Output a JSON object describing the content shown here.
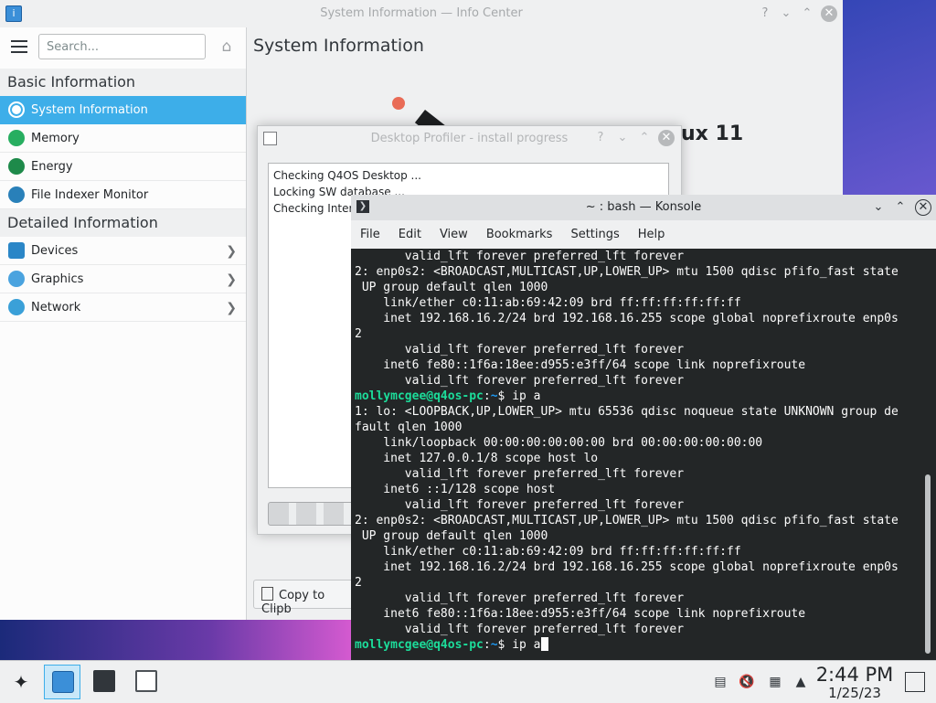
{
  "infocenter": {
    "window_title": "System Information — Info Center",
    "search_placeholder": "Search...",
    "sections": [
      {
        "title": "Basic Information",
        "items": [
          {
            "label": "System Information",
            "icon": "info-icon",
            "color": "#3b8fd8",
            "selected": true
          },
          {
            "label": "Memory",
            "icon": "memory-icon",
            "color": "#27ae60"
          },
          {
            "label": "Energy",
            "icon": "energy-icon",
            "color": "#1e8a4a"
          },
          {
            "label": "File Indexer Monitor",
            "icon": "file-indexer-icon",
            "color": "#2980b9"
          }
        ]
      },
      {
        "title": "Detailed Information",
        "items": [
          {
            "label": "Devices",
            "icon": "devices-icon",
            "color": "#2a86c7",
            "chevron": true
          },
          {
            "label": "Graphics",
            "icon": "graphics-icon",
            "color": "#4aa3df",
            "chevron": true
          },
          {
            "label": "Network",
            "icon": "network-icon",
            "color": "#3aa0d8",
            "chevron": true
          }
        ]
      }
    ],
    "page_title": "System Information",
    "os_name_fragment": "ux 11",
    "copy_button_label": "Copy to Clipb"
  },
  "profiler_dialog": {
    "title": "Desktop Profiler - install progress",
    "log_lines": [
      "Checking Q4OS Desktop ...",
      "Locking SW database ...",
      "Checking Interr"
    ]
  },
  "konsole": {
    "title": "~ : bash — Konsole",
    "menu": [
      "File",
      "Edit",
      "View",
      "Bookmarks",
      "Settings",
      "Help"
    ],
    "lines": [
      {
        "text": "       valid_lft forever preferred_lft forever"
      },
      {
        "text": "2: enp0s2: <BROADCAST,MULTICAST,UP,LOWER_UP> mtu 1500 qdisc pfifo_fast state"
      },
      {
        "text": " UP group default qlen 1000"
      },
      {
        "text": "    link/ether c0:11:ab:69:42:09 brd ff:ff:ff:ff:ff:ff"
      },
      {
        "text": "    inet 192.168.16.2/24 brd 192.168.16.255 scope global noprefixroute enp0s"
      },
      {
        "text": "2"
      },
      {
        "text": "       valid_lft forever preferred_lft forever"
      },
      {
        "text": "    inet6 fe80::1f6a:18ee:d955:e3ff/64 scope link noprefixroute"
      },
      {
        "text": "       valid_lft forever preferred_lft forever"
      },
      {
        "prompt": true,
        "user": "mollymcgee@q4os-pc",
        "sep": ":",
        "path": "~",
        "cmd": "$ ip a"
      },
      {
        "text": "1: lo: <LOOPBACK,UP,LOWER_UP> mtu 65536 qdisc noqueue state UNKNOWN group de"
      },
      {
        "text": "fault qlen 1000"
      },
      {
        "text": "    link/loopback 00:00:00:00:00:00 brd 00:00:00:00:00:00"
      },
      {
        "text": "    inet 127.0.0.1/8 scope host lo"
      },
      {
        "text": "       valid_lft forever preferred_lft forever"
      },
      {
        "text": "    inet6 ::1/128 scope host"
      },
      {
        "text": "       valid_lft forever preferred_lft forever"
      },
      {
        "text": "2: enp0s2: <BROADCAST,MULTICAST,UP,LOWER_UP> mtu 1500 qdisc pfifo_fast state"
      },
      {
        "text": " UP group default qlen 1000"
      },
      {
        "text": "    link/ether c0:11:ab:69:42:09 brd ff:ff:ff:ff:ff:ff"
      },
      {
        "text": "    inet 192.168.16.2/24 brd 192.168.16.255 scope global noprefixroute enp0s"
      },
      {
        "text": "2"
      },
      {
        "text": "       valid_lft forever preferred_lft forever"
      },
      {
        "text": "    inet6 fe80::1f6a:18ee:d955:e3ff/64 scope link noprefixroute"
      },
      {
        "text": "       valid_lft forever preferred_lft forever"
      },
      {
        "prompt": true,
        "user": "mollymcgee@q4os-pc",
        "sep": ":",
        "path": "~",
        "cmd": "$ ip a",
        "cursor": true
      }
    ],
    "colors": {
      "user": "#1cdc9a",
      "path": "#1d99f3",
      "bg": "#232627"
    }
  },
  "taskbar": {
    "time": "2:44 PM",
    "date": "1/25/23",
    "tasks": [
      {
        "name": "info-center-task",
        "icon": "info-icon",
        "active": true
      },
      {
        "name": "konsole-task",
        "icon": "terminal-icon",
        "active": false
      },
      {
        "name": "desktop-profiler-task",
        "icon": "settings-icon",
        "active": false
      }
    ],
    "tray": [
      "clipboard-icon",
      "audio-muted-icon",
      "network-wired-icon",
      "expand-tray-icon"
    ]
  }
}
